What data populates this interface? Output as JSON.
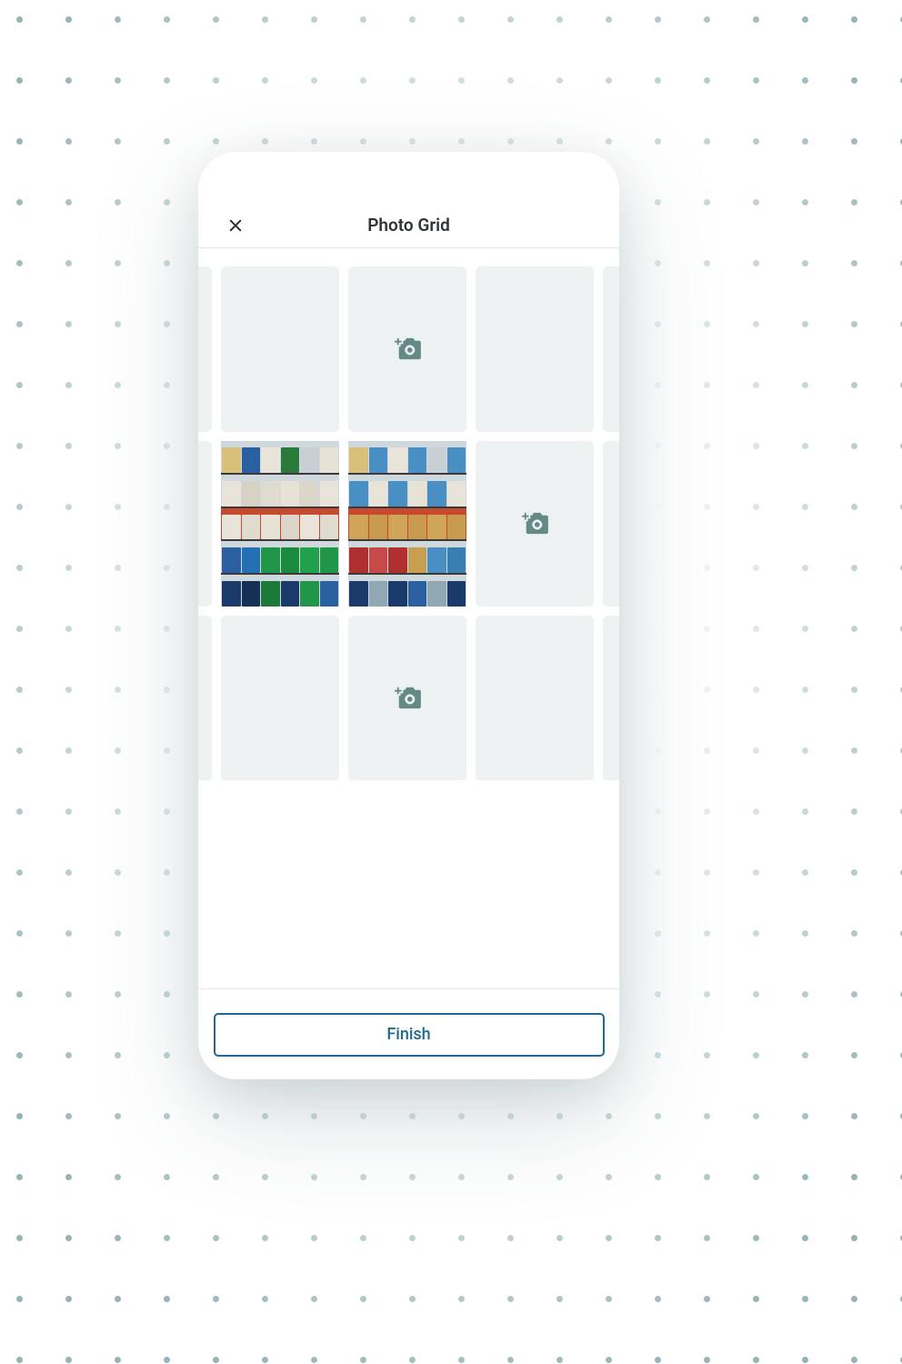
{
  "header": {
    "title": "Photo Grid"
  },
  "grid": {
    "rows": [
      {
        "tiles": [
          "empty",
          "add-camera",
          "empty",
          "edge"
        ]
      },
      {
        "tiles": [
          "photo",
          "photo",
          "add-camera",
          "edge"
        ]
      },
      {
        "tiles": [
          "empty",
          "add-camera",
          "empty",
          "edge"
        ]
      }
    ]
  },
  "footer": {
    "finish_label": "Finish"
  },
  "colors": {
    "tile_bg": "#edf1f2",
    "icon": "#638a86",
    "accent": "#1e6b8c"
  }
}
